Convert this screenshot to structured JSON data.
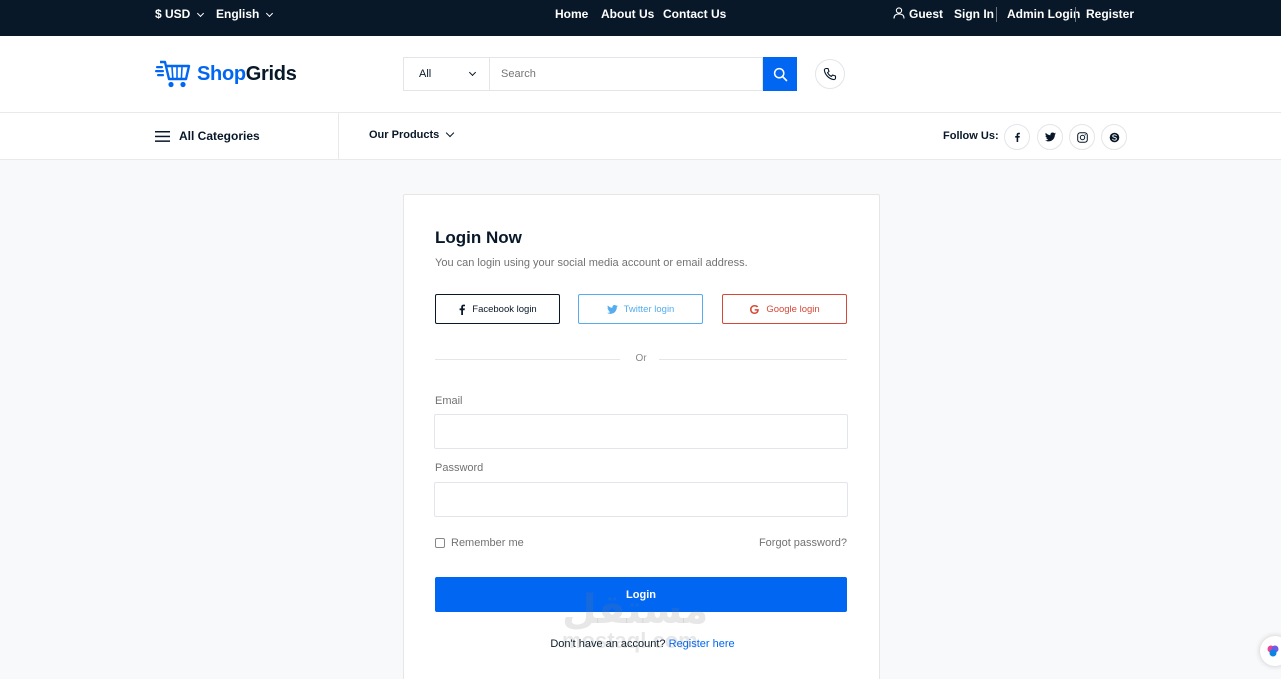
{
  "topbar": {
    "currency": "$ USD",
    "language": "English",
    "nav": [
      "Home",
      "About Us",
      "Contact Us"
    ],
    "guest": "Guest",
    "sign_in": "Sign In",
    "admin_login": "Admin Login",
    "register": "Register"
  },
  "header": {
    "logo_part1": "Shop",
    "logo_part2": "Grids",
    "category_select": "All",
    "search_placeholder": "Search"
  },
  "navbar": {
    "all_categories": "All Categories",
    "our_products": "Our Products",
    "follow_us": "Follow Us:",
    "social_icons": [
      "facebook-icon",
      "twitter-icon",
      "instagram-icon",
      "skype-icon"
    ]
  },
  "login": {
    "title": "Login Now",
    "subtitle": "You can login using your social media account or email address.",
    "facebook_btn": "Facebook login",
    "twitter_btn": "Twitter login",
    "google_btn": "Google login",
    "divider": "Or",
    "email_label": "Email",
    "password_label": "Password",
    "remember": "Remember me",
    "forgot": "Forgot password?",
    "submit": "Login",
    "no_account": "Don't have an account?",
    "register_link": "Register here"
  },
  "colors": {
    "brand_blue": "#0167f3",
    "dark": "#081828",
    "twitter": "#55acee",
    "google": "#d64937"
  }
}
